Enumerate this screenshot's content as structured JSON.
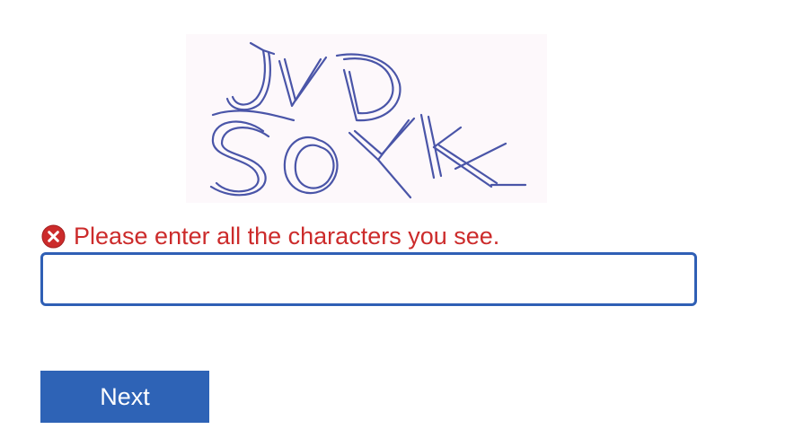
{
  "captcha": {
    "icon": "captcha-image"
  },
  "error": {
    "icon": "error-x-icon",
    "message": "Please enter all the characters you see.",
    "color": "#cc2b2b"
  },
  "answer_input": {
    "value": "",
    "border_color": "#2f5fb5"
  },
  "actions": {
    "next_label": "Next",
    "button_color": "#2e63b6"
  }
}
